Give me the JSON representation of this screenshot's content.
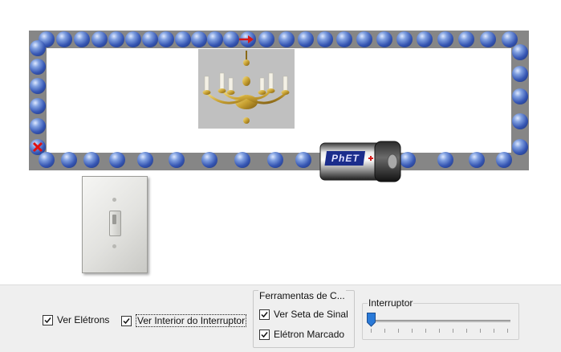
{
  "simulation": {
    "title": "",
    "battery_label": "PhET",
    "colors": {
      "wire": "#868686",
      "electron": "#3656b3",
      "lamp_background": "#c0c0c0"
    }
  },
  "controls": {
    "show_electrons": {
      "label": "Ver Elétrons",
      "checked": true
    },
    "show_switch_interior": {
      "label": "Ver Interior do Interruptor",
      "checked": true
    },
    "tools": {
      "title": "Ferramentas de C...",
      "show_signal_arrow": {
        "label": "Ver Seta de Sinal",
        "checked": true
      },
      "marked_electron": {
        "label": "Elétron Marcado",
        "checked": true
      }
    },
    "switch_slider": {
      "title": "Interruptor",
      "value": 0
    }
  }
}
